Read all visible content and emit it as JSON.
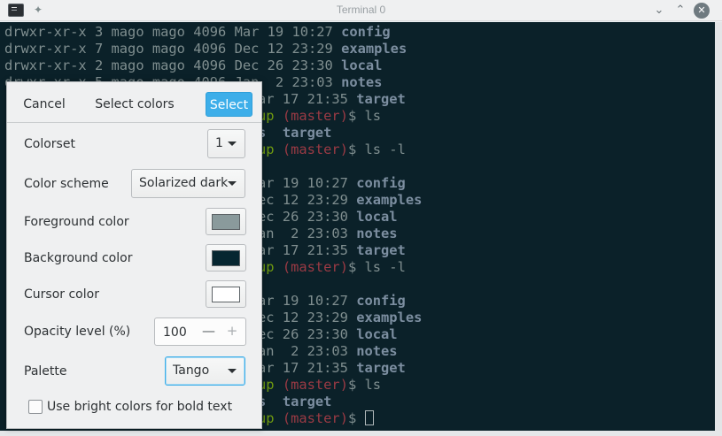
{
  "window": {
    "title": "Terminal 0",
    "app_icon": "terminal-icon",
    "pin_icon": "pin-icon",
    "minimize": "⌄",
    "maximize": "⌃",
    "close": "✕"
  },
  "terminal": {
    "background": "#0b2129",
    "lines": [
      {
        "perm": "drwxr-xr-x",
        "links": "3",
        "owner": "mago",
        "group": "mago",
        "size": "4096",
        "date": "Mar 19 10:27",
        "name": "config"
      },
      {
        "perm": "drwxr-xr-x",
        "links": "7",
        "owner": "mago",
        "group": "mago",
        "size": "4096",
        "date": "Dec 12 23:29",
        "name": "examples"
      },
      {
        "perm": "drwxr-xr-x",
        "links": "2",
        "owner": "mago",
        "group": "mago",
        "size": "4096",
        "date": "Dec 26 23:30",
        "name": "local"
      },
      {
        "perm": "drwxr-xr-x",
        "links": "5",
        "owner": "mago",
        "group": "mago",
        "size": "4096",
        "date": "Jan  2 23:03",
        "name": "notes"
      }
    ],
    "visible_fragments": {
      "row5": {
        "date": "ar 17 21:35",
        "name": "target"
      },
      "prompt_tail": "up",
      "branch": "(master)",
      "cmd_ls": "$ ls",
      "cmd_ls_l": "$ ls -l",
      "row7_a": "s",
      "row7_b": "target",
      "block2": [
        {
          "date": "ar 19 10:27",
          "name": "config"
        },
        {
          "date": "ec 12 23:29",
          "name": "examples"
        },
        {
          "date": "ec 26 23:30",
          "name": "local"
        },
        {
          "date": "an  2 23:03",
          "name": "notes"
        },
        {
          "date": "ar 17 21:35",
          "name": "target"
        }
      ],
      "block3": [
        {
          "date": "ar 19 10:27",
          "name": "config"
        },
        {
          "date": "ec 12 23:29",
          "name": "examples"
        },
        {
          "date": "ec 26 23:30",
          "name": "local"
        },
        {
          "date": "an  2 23:03",
          "name": "notes"
        },
        {
          "date": "ar 17 21:35",
          "name": "target"
        }
      ],
      "final_prompt": "$ "
    }
  },
  "dialog": {
    "cancel_label": "Cancel",
    "title": "Select colors",
    "select_label": "Select",
    "colorset_label": "Colorset",
    "colorset_value": "1",
    "color_scheme_label": "Color scheme",
    "color_scheme_value": "Solarized dark",
    "foreground_label": "Foreground color",
    "foreground_color": "#8a9a9c",
    "background_label": "Background color",
    "background_color": "#062630",
    "cursor_label": "Cursor color",
    "cursor_color": "#ffffff",
    "opacity_label": "Opacity level (%)",
    "opacity_value": "100",
    "opacity_minus": "—",
    "opacity_plus": "+",
    "palette_label": "Palette",
    "palette_value": "Tango",
    "bold_bright_label": "Use bright colors for bold text",
    "bold_bright_checked": false
  }
}
